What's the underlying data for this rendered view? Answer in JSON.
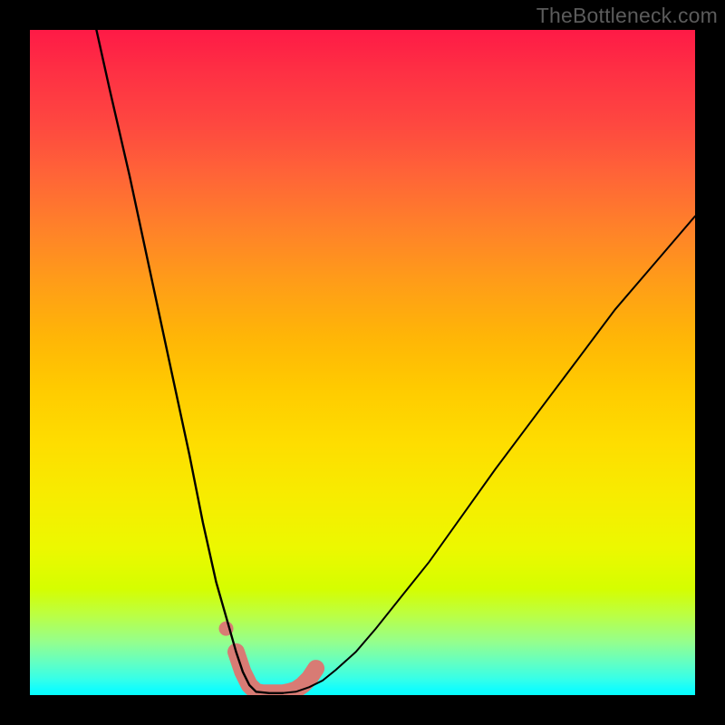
{
  "watermark": "TheBottleneck.com",
  "gradient_colors": {
    "top": "#fe1a46",
    "mid_upper": "#ff8229",
    "mid": "#ffcb00",
    "mid_lower": "#ecf800",
    "bottom": "#06feff"
  },
  "chart_data": {
    "type": "line",
    "title": "",
    "xlabel": "",
    "ylabel": "",
    "xlim": [
      0,
      100
    ],
    "ylim": [
      0,
      100
    ],
    "notes": "Background vertical gradient encodes bottleneck severity (red=high, cyan=low). Two black curves form a V/U shape converging near x≈33–40 at y≈0; a salmon highlight marks the trough region.",
    "series": [
      {
        "name": "left-curve",
        "x": [
          10,
          12,
          15,
          18,
          21,
          24,
          26,
          28,
          30,
          31,
          32,
          33,
          34,
          36,
          38
        ],
        "y": [
          100,
          91,
          78,
          64,
          50,
          36,
          26,
          17,
          10,
          6.5,
          3.5,
          1.5,
          0.5,
          0.3,
          0.3
        ]
      },
      {
        "name": "right-curve",
        "x": [
          38,
          40,
          42,
          44,
          46,
          49,
          52,
          56,
          60,
          65,
          70,
          76,
          82,
          88,
          94,
          100
        ],
        "y": [
          0.3,
          0.5,
          1.2,
          2.2,
          3.8,
          6.5,
          10,
          15,
          20,
          27,
          34,
          42,
          50,
          58,
          65,
          72
        ]
      },
      {
        "name": "trough-highlight",
        "color": "#d87b74",
        "x": [
          31,
          32,
          33,
          34,
          35,
          36,
          37,
          38,
          39,
          40,
          41,
          42,
          43
        ],
        "y": [
          6.5,
          3.5,
          1.5,
          0.5,
          0.3,
          0.3,
          0.3,
          0.3,
          0.5,
          0.8,
          1.5,
          2.5,
          4.0
        ]
      },
      {
        "name": "isolated-dot",
        "color": "#d87b74",
        "x": [
          29.5
        ],
        "y": [
          10
        ]
      }
    ]
  }
}
